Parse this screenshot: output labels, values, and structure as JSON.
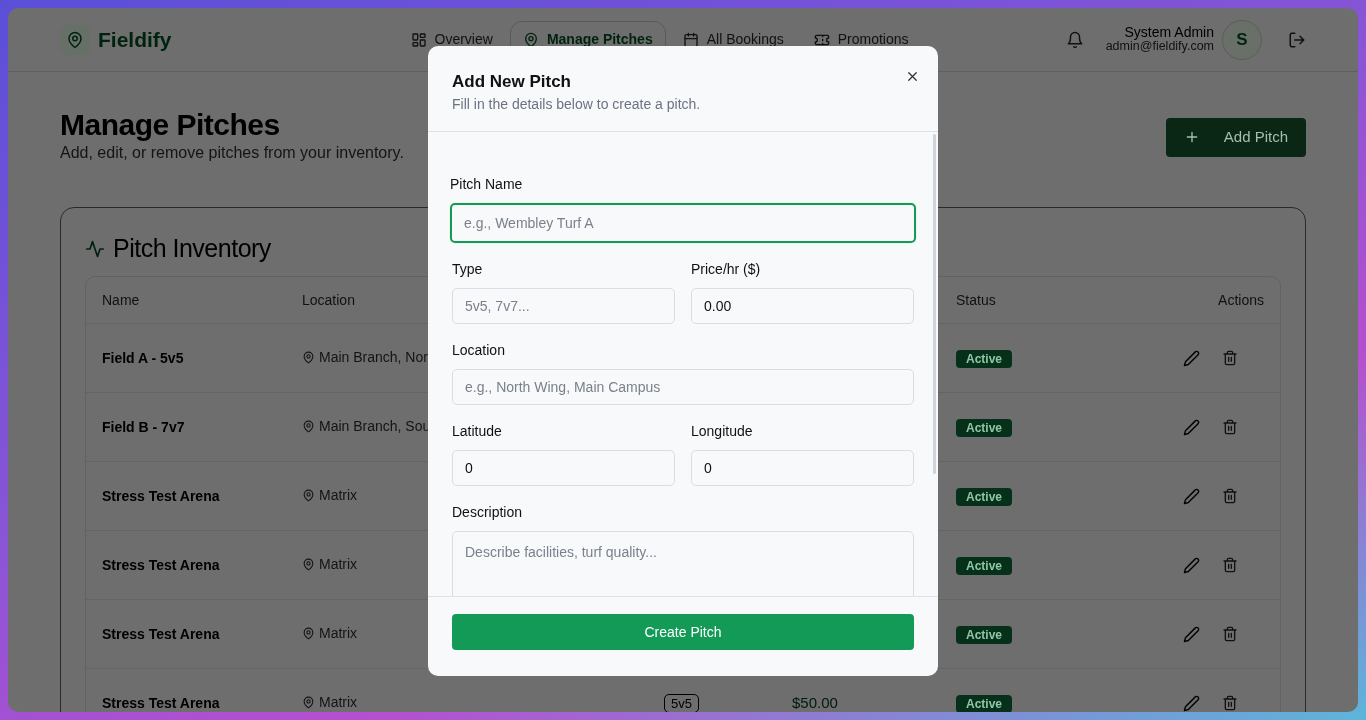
{
  "app": {
    "brand": "Fieldify"
  },
  "nav": [
    {
      "label": "Overview",
      "selected": false
    },
    {
      "label": "Manage Pitches",
      "selected": true
    },
    {
      "label": "All Bookings",
      "selected": false
    },
    {
      "label": "Promotions",
      "selected": false
    }
  ],
  "user": {
    "name": "System Admin",
    "email": "admin@fieldify.com",
    "initial": "S"
  },
  "page": {
    "title": "Manage Pitches",
    "subtitle": "Add, edit, or remove pitches from your inventory.",
    "add_button": "Add Pitch"
  },
  "inventory": {
    "title": "Pitch Inventory",
    "columns": [
      "Name",
      "Location",
      "Status",
      "Actions"
    ],
    "rows": [
      {
        "name": "Field A - 5v5",
        "location": "Main Branch, Nor",
        "status": "Active"
      },
      {
        "name": "Field B - 7v7",
        "location": "Main Branch, Sou",
        "status": "Active"
      },
      {
        "name": "Stress Test Arena",
        "location": "Matrix",
        "status": "Active"
      },
      {
        "name": "Stress Test Arena",
        "location": "Matrix",
        "status": "Active"
      },
      {
        "name": "Stress Test Arena",
        "location": "Matrix",
        "status": "Active"
      },
      {
        "name": "Stress Test Arena",
        "location": "Matrix",
        "type": "5v5",
        "price": "$50.00",
        "status": "Active"
      }
    ]
  },
  "modal": {
    "title": "Add New Pitch",
    "subtitle": "Fill in the details below to create a pitch.",
    "rows": [
      [
        {
          "kind": "text",
          "label": "Pitch Name",
          "placeholder": "e.g., Wembley Turf A",
          "focused": true
        }
      ],
      [
        {
          "kind": "text",
          "label": "Type",
          "placeholder": "5v5, 7v7...",
          "focused": false
        },
        {
          "kind": "text",
          "label": "Price/hr ($)",
          "value": "0.00",
          "focused": false
        }
      ],
      [
        {
          "kind": "text",
          "label": "Location",
          "placeholder": "e.g., North Wing, Main Campus",
          "focused": false
        }
      ],
      [
        {
          "kind": "text",
          "label": "Latitude",
          "value": "0",
          "focused": false
        },
        {
          "kind": "text",
          "label": "Longitude",
          "value": "0",
          "focused": false
        }
      ],
      [
        {
          "kind": "textarea",
          "label": "Description",
          "placeholder": "Describe facilities, turf quality...",
          "focused": false
        }
      ]
    ],
    "submit": "Create Pitch"
  }
}
